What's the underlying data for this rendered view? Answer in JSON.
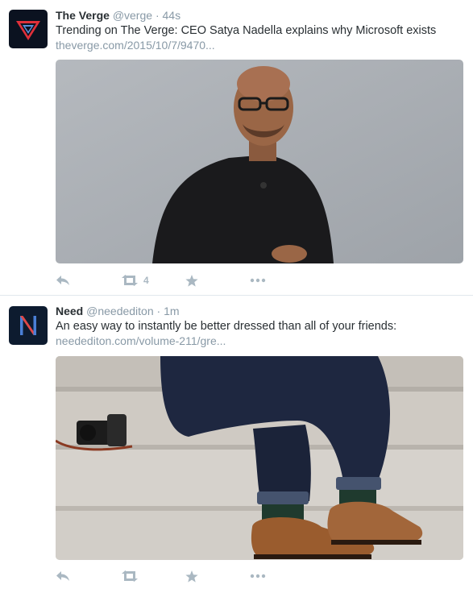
{
  "tweets": [
    {
      "author": "The Verge",
      "handle": "@verge",
      "separator": "·",
      "time": "44s",
      "text": "Trending on The Verge: CEO Satya Nadella explains why Microsoft exists",
      "link": "theverge.com/2015/10/7/9470...",
      "retweet_count": "4",
      "avatar_icon": "verge-logo-icon",
      "colors": {
        "avatar_bg": "#0b1220",
        "logo_red": "#e0303a",
        "logo_blue": "#5a8fd8"
      }
    },
    {
      "author": "Need",
      "handle": "@needediton",
      "separator": "·",
      "time": "1m",
      "text": "An easy way to instantly be better dressed than all of your friends:",
      "link": "needediton.com/volume-211/gre...",
      "retweet_count": "",
      "avatar_icon": "need-logo-icon",
      "avatar_letter": "N",
      "colors": {
        "avatar_bg": "#0d1b2f",
        "letter_blue": "#4a7fd6",
        "letter_red": "#e04848"
      }
    }
  ],
  "icons": {
    "reply": "reply-icon",
    "retweet": "retweet-icon",
    "favorite": "star-icon",
    "more": "more-icon"
  },
  "colors": {
    "text": "#292f33",
    "muted": "#8899a6",
    "action": "#aab8c2",
    "divider": "#e1e8ed"
  }
}
